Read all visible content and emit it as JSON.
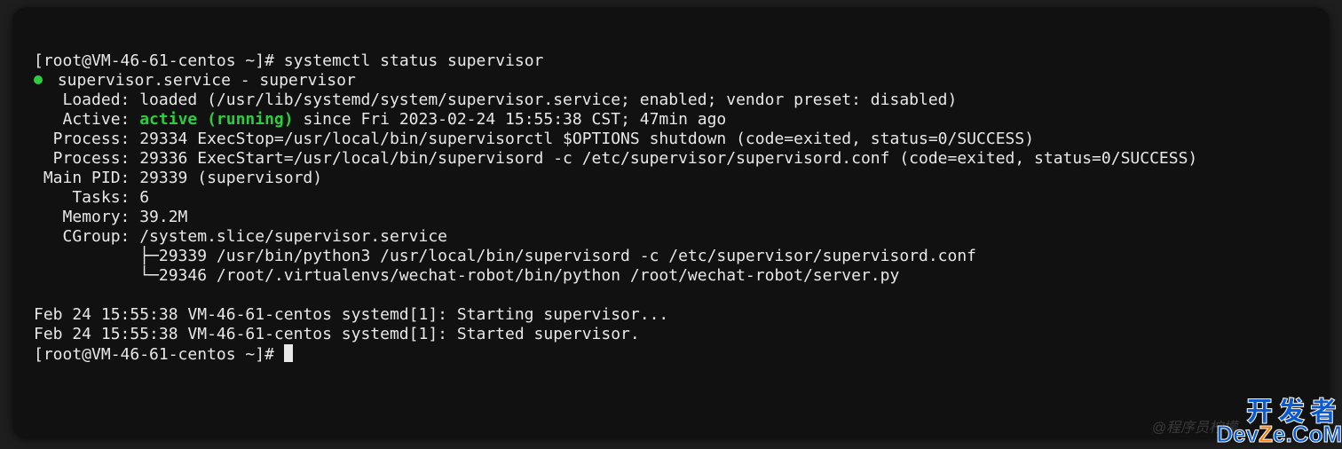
{
  "prompt1": {
    "user_host": "[root@VM-46-61-centos ~]#",
    "command": "systemctl status supervisor"
  },
  "status": {
    "header": " supervisor.service - supervisor",
    "loaded": "   Loaded: loaded (/usr/lib/systemd/system/supervisor.service; enabled; vendor preset: disabled)",
    "active_prefix": "   Active: ",
    "active_state": "active (running)",
    "active_suffix": " since Fri 2023-02-24 15:55:38 CST; 47min ago",
    "process1": "  Process: 29334 ExecStop=/usr/local/bin/supervisorctl $OPTIONS shutdown (code=exited, status=0/SUCCESS)",
    "process2": "  Process: 29336 ExecStart=/usr/local/bin/supervisord -c /etc/supervisor/supervisord.conf (code=exited, status=0/SUCCESS)",
    "mainpid": " Main PID: 29339 (supervisord)",
    "tasks": "    Tasks: 6",
    "memory": "   Memory: 39.2M",
    "cgroup": "   CGroup: /system.slice/supervisor.service",
    "cg1": "           ├─29339 /usr/bin/python3 /usr/local/bin/supervisord -c /etc/supervisor/supervisord.conf",
    "cg2": "           └─29346 /root/.virtualenvs/wechat-robot/bin/python /root/wechat-robot/server.py"
  },
  "log": {
    "line1": "Feb 24 15:55:38 VM-46-61-centos systemd[1]: Starting supervisor...",
    "line2": "Feb 24 15:55:38 VM-46-61-centos systemd[1]: Started supervisor."
  },
  "prompt2": {
    "user_host": "[root@VM-46-61-centos ~]#"
  },
  "watermark": "@程序员柠檬",
  "logo": {
    "cn": "开发者",
    "en_pre": "Dev",
    "en_mid": "Z",
    "en_post": "e.CoM"
  }
}
